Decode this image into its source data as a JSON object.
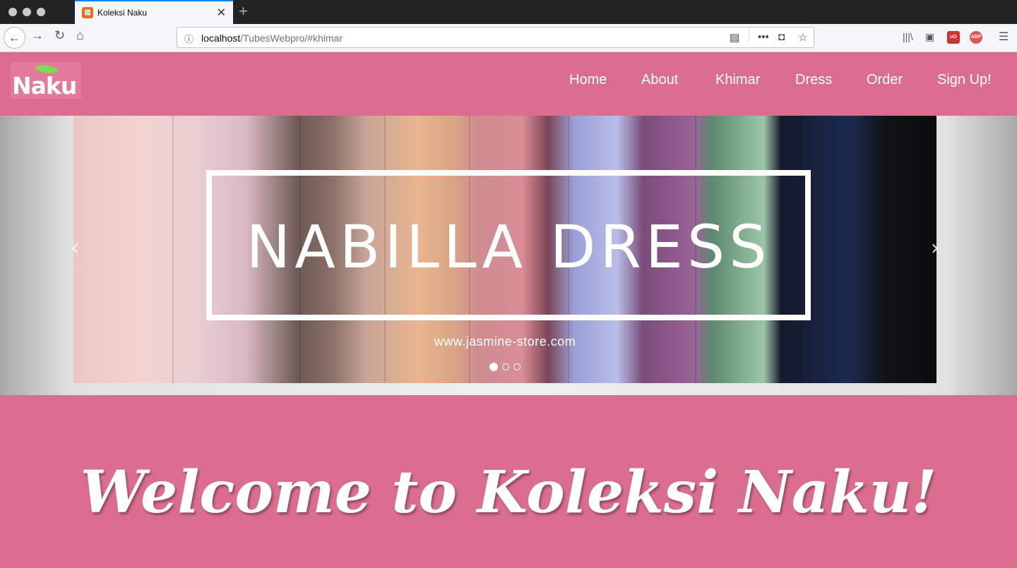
{
  "browser": {
    "tab_title": "Koleksi Naku",
    "tab_favicon": "xampp-icon",
    "url_host": "localhost",
    "url_path": "/TubesWebpro/#khimar"
  },
  "site": {
    "logo_text": "Naku",
    "nav": [
      "Home",
      "About",
      "Khimar",
      "Dress",
      "Order",
      "Sign Up!"
    ],
    "colors": {
      "brand_pink": "#db6e8f",
      "leaf_green": "#7ed957"
    }
  },
  "carousel": {
    "slide_title": "NABILLA DRESS",
    "slide_site": "www.jasmine-store.com",
    "slide_count": 3,
    "active_index": 0
  },
  "welcome": {
    "title": "Welcome to Koleksi Naku!"
  }
}
